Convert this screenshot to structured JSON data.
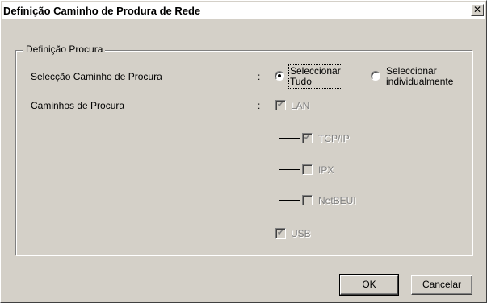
{
  "window": {
    "title": "Definição Caminho de Produra de Rede",
    "close_glyph": "✕"
  },
  "group": {
    "legend": "Definição Procura"
  },
  "path_selection": {
    "label": "Selecção Caminho de Procura",
    "colon": ":",
    "options": [
      {
        "label_line1": "Seleccionar",
        "label_line2": "Tudo",
        "selected": true
      },
      {
        "label_line1": "Seleccionar",
        "label_line2": "individualmente",
        "selected": false
      }
    ]
  },
  "search_paths": {
    "label": "Caminhos de Procura",
    "colon": ":",
    "lan": {
      "label": "LAN",
      "checked": true,
      "enabled": false
    },
    "tcpip": {
      "label": "TCP/IP",
      "checked": true,
      "enabled": false
    },
    "ipx": {
      "label": "IPX",
      "checked": false,
      "enabled": false
    },
    "netbeui": {
      "label": "NetBEUI",
      "checked": false,
      "enabled": false
    },
    "usb": {
      "label": "USB",
      "checked": true,
      "enabled": false
    }
  },
  "buttons": {
    "ok": "OK",
    "cancel": "Cancelar"
  },
  "icons": {
    "check_glyph": "✔"
  }
}
